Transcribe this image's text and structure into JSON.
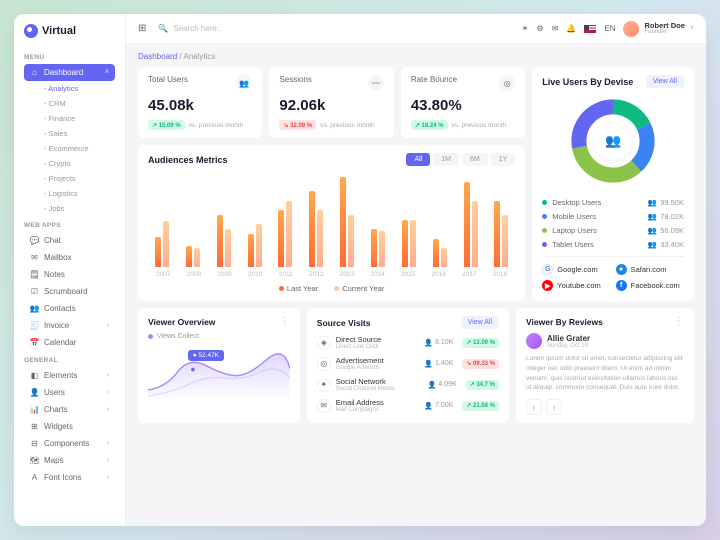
{
  "brand": "Virtual",
  "search_placeholder": "Search here..",
  "lang_label": "EN",
  "user": {
    "name": "Robert Doe",
    "role": "Founder"
  },
  "breadcrumb": {
    "root": "Dashboard",
    "current": "Analytics"
  },
  "menu": {
    "section1_label": "MENU",
    "dashboard_label": "Dashboard",
    "sub_items": [
      "Analytics",
      "CRM",
      "Finance",
      "Sales",
      "Ecommerce",
      "Crypto",
      "Projects",
      "Logistics",
      "Jobs"
    ],
    "section2_label": "WEB APPS",
    "web_apps": [
      {
        "icon": "💬",
        "label": "Chat",
        "chev": false
      },
      {
        "icon": "✉",
        "label": "Mailbox",
        "chev": false
      },
      {
        "icon": "🗒",
        "label": "Notes",
        "chev": false
      },
      {
        "icon": "☑",
        "label": "Scrumboard",
        "chev": false
      },
      {
        "icon": "👥",
        "label": "Contacts",
        "chev": false
      },
      {
        "icon": "🧾",
        "label": "Invoice",
        "chev": true
      },
      {
        "icon": "📅",
        "label": "Calendar",
        "chev": false
      }
    ],
    "section3_label": "GENERAL",
    "general": [
      {
        "icon": "◧",
        "label": "Elements",
        "chev": true
      },
      {
        "icon": "👤",
        "label": "Users",
        "chev": true
      },
      {
        "icon": "📊",
        "label": "Charts",
        "chev": true
      },
      {
        "icon": "⊞",
        "label": "Widgets",
        "chev": false
      },
      {
        "icon": "⊟",
        "label": "Components",
        "chev": true
      },
      {
        "icon": "🗺",
        "label": "Maps",
        "chev": true
      },
      {
        "icon": "A",
        "label": "Font Icons",
        "chev": true
      }
    ]
  },
  "stats": [
    {
      "label": "Total Users",
      "icon": "👥",
      "value": "45.08k",
      "badge": "↗ 15.09 %",
      "dir": "up",
      "sub": "vs. previous month"
    },
    {
      "label": "Sessions",
      "icon": "〰",
      "value": "92.06k",
      "badge": "↘ 32.09 %",
      "dir": "down",
      "sub": "vs. previous month"
    },
    {
      "label": "Rate Bounce",
      "icon": "◎",
      "value": "43.80%",
      "badge": "↗ 18.24 %",
      "dir": "up",
      "sub": "vs. previous month"
    }
  ],
  "live": {
    "title": "Live Users By Devise",
    "view_all": "View All",
    "donut": [
      {
        "color": "#10b981",
        "pct": 18
      },
      {
        "color": "#3b82f6",
        "pct": 20
      },
      {
        "color": "#8bc34a",
        "pct": 34
      },
      {
        "color": "#6366f1",
        "pct": 28
      }
    ],
    "legend": [
      {
        "color": "#10b981",
        "label": "Desktop Users",
        "value": "99.50K"
      },
      {
        "color": "#3b82f6",
        "label": "Mobile Users",
        "value": "78.02K"
      },
      {
        "color": "#8bc34a",
        "label": "Laptop Users",
        "value": "56.09K"
      },
      {
        "color": "#6366f1",
        "label": "Tablet Users",
        "value": "33.40K"
      }
    ],
    "refs": [
      {
        "letter": "G",
        "color": "#fff",
        "border": "#ddd",
        "txtcolor": "#4285f4",
        "label": "Google.com"
      },
      {
        "letter": "●",
        "color": "#1e88e5",
        "label": "Safari.com"
      },
      {
        "letter": "▶",
        "color": "#ff0000",
        "label": "Youtube.com"
      },
      {
        "letter": "f",
        "color": "#1877f2",
        "label": "Facebook.com"
      }
    ]
  },
  "metrics": {
    "title": "Audiences Metrics",
    "tabs": [
      "All",
      "1M",
      "6M",
      "1Y"
    ],
    "legend": [
      "Last Year",
      "Current Year"
    ]
  },
  "chart_data": {
    "type": "bar",
    "title": "Audiences Metrics",
    "categories": [
      "2007",
      "2008",
      "2009",
      "2010",
      "2011",
      "2012",
      "2013",
      "2014",
      "2015",
      "2016",
      "2017",
      "2018"
    ],
    "series": [
      {
        "name": "Last Year",
        "values": [
          32,
          22,
          55,
          35,
          60,
          80,
          95,
          40,
          50,
          30,
          90,
          70
        ]
      },
      {
        "name": "Current Year",
        "values": [
          48,
          20,
          40,
          45,
          70,
          60,
          55,
          38,
          50,
          20,
          70,
          55
        ]
      }
    ],
    "ylim": [
      0,
      100
    ]
  },
  "viewer": {
    "title": "Viewer Overview",
    "series_label": "Views Collect",
    "tip": "● 52.47K"
  },
  "sources": {
    "title": "Source Visits",
    "view_all": "View All",
    "rows": [
      {
        "icon": "◈",
        "name": "Direct Source",
        "sub": "Direct Link Click",
        "val": "8.10K",
        "badge": "↗ 13.09 %",
        "dir": "up"
      },
      {
        "icon": "◎",
        "name": "Advertisement",
        "sub": "Google Adwords",
        "val": "1.40K",
        "badge": "↘ 09.33 %",
        "dir": "down"
      },
      {
        "icon": "✦",
        "name": "Social Network",
        "sub": "Social Channel Media",
        "val": "4.09K",
        "badge": "↗ 34.7 %",
        "dir": "up"
      },
      {
        "icon": "✉",
        "name": "Email Address",
        "sub": "Mail Campaigns",
        "val": "7.00K",
        "badge": "↗ 21.04 %",
        "dir": "up"
      }
    ]
  },
  "review": {
    "title": "Viewer By Reviews",
    "author": "Allie Grater",
    "date": "Sunday, Oct 19",
    "body": "Lorem ipsum dolor sit amet, consectetur adipiscing elit integer nec odio praesent libero. Ut enim ad minim veniam, quis nostrud exercitation ullamco laboris nisi ut aliquip. commodo consequat. Duis aute irure dolor."
  }
}
